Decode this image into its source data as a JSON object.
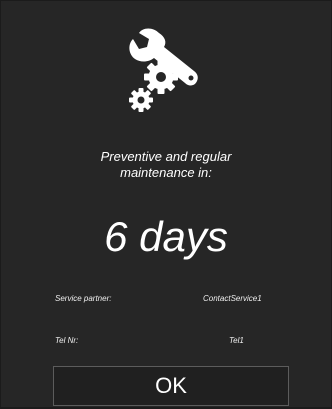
{
  "icon": "maintenance-wrench-gears-icon",
  "message": {
    "line1": "Preventive and regular",
    "line2": "maintenance in:"
  },
  "countdown": "6 days",
  "service_partner": {
    "label": "Service partner:",
    "value": "ContactService1"
  },
  "tel": {
    "label": "Tel Nr:",
    "value": "Tel1"
  },
  "ok_label": "OK",
  "colors": {
    "background": "#262626",
    "text": "#ffffff",
    "button_border": "#5c5c5c"
  }
}
